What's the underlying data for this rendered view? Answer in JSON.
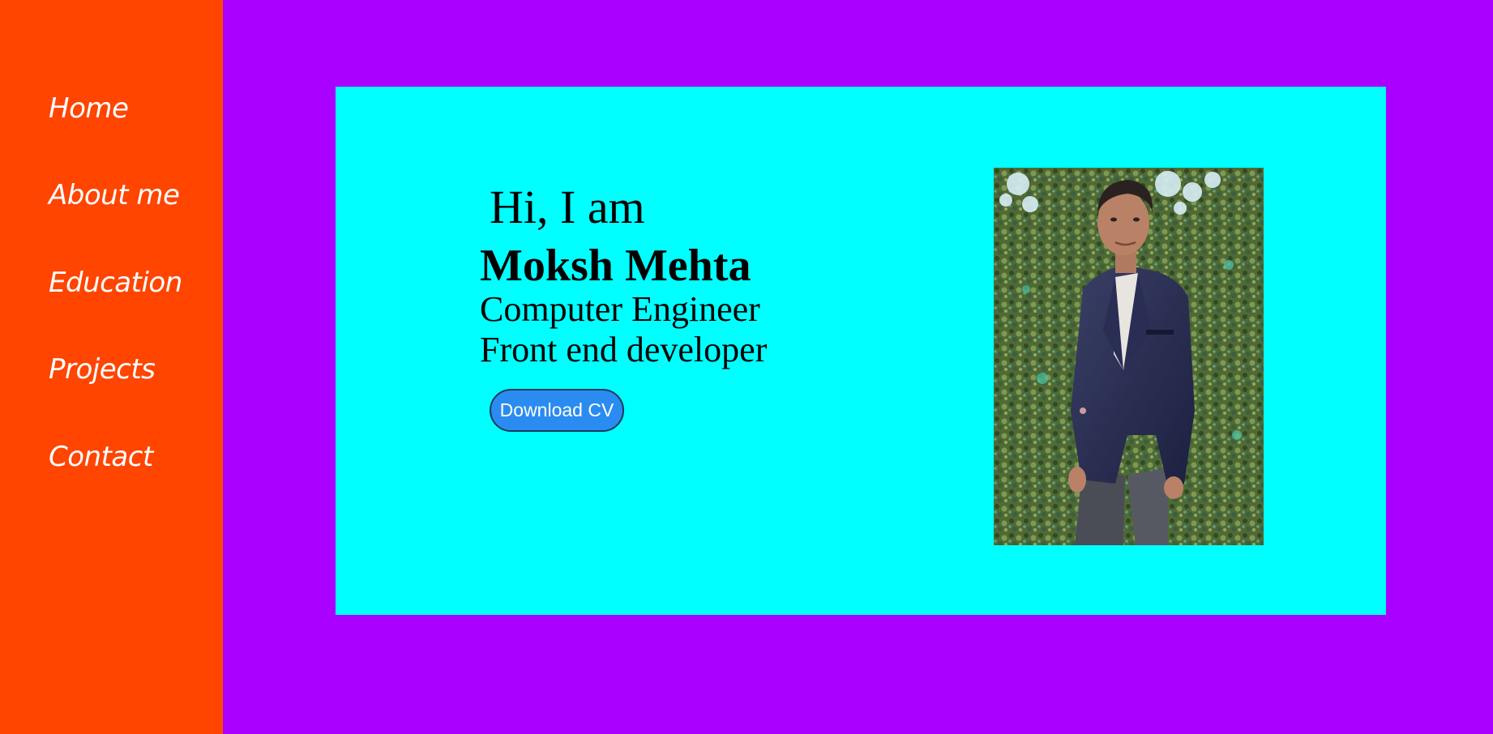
{
  "nav": {
    "items": [
      {
        "label": "Home"
      },
      {
        "label": "About me"
      },
      {
        "label": "Education"
      },
      {
        "label": "Projects"
      },
      {
        "label": "Contact"
      }
    ]
  },
  "hero": {
    "greeting": "Hi, I am",
    "name": "Moksh Mehta",
    "roles": [
      "Computer Engineer",
      "Front end developer"
    ],
    "cv_button_label": "Download CV",
    "photo_icon": "profile-photo"
  },
  "colors": {
    "page_background": "#aa00ff",
    "sidebar_background": "#ff4500",
    "card_background": "#00ffff",
    "button_background": "#2a8cf0",
    "nav_text": "#ffffff"
  }
}
